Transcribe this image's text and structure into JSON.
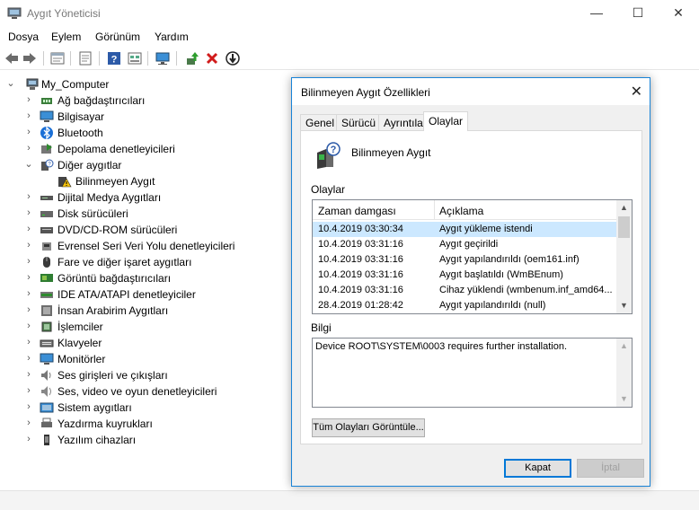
{
  "window": {
    "title": "Aygıt Yöneticisi",
    "controls": {
      "minimize": "—",
      "maximize": "☐",
      "close": "✕"
    }
  },
  "menu": [
    "Dosya",
    "Eylem",
    "Görünüm",
    "Yardım"
  ],
  "toolbar": [
    "back-icon",
    "forward-icon",
    "properties-icon",
    "show-hidden-icon",
    "help-icon",
    "view-icon",
    "monitor-icon",
    "update-driver-icon",
    "uninstall-icon",
    "disable-icon"
  ],
  "tree": {
    "root": "My_Computer",
    "items": [
      {
        "label": "Ağ bağdaştırıcıları",
        "expanded": false
      },
      {
        "label": "Bilgisayar",
        "expanded": false
      },
      {
        "label": "Bluetooth",
        "expanded": false
      },
      {
        "label": "Depolama denetleyicileri",
        "expanded": false
      },
      {
        "label": "Diğer aygıtlar",
        "expanded": true
      },
      {
        "label": "Bilinmeyen Aygıt",
        "child": true
      },
      {
        "label": "Dijital Medya Aygıtları",
        "expanded": false
      },
      {
        "label": "Disk sürücüleri",
        "expanded": false
      },
      {
        "label": "DVD/CD-ROM sürücüleri",
        "expanded": false
      },
      {
        "label": "Evrensel Seri Veri Yolu denetleyicileri",
        "expanded": false
      },
      {
        "label": "Fare ve diğer işaret aygıtları",
        "expanded": false
      },
      {
        "label": "Görüntü bağdaştırıcıları",
        "expanded": false
      },
      {
        "label": "IDE ATA/ATAPI denetleyiciler",
        "expanded": false
      },
      {
        "label": "İnsan Arabirim Aygıtları",
        "expanded": false
      },
      {
        "label": "İşlemciler",
        "expanded": false
      },
      {
        "label": "Klavyeler",
        "expanded": false
      },
      {
        "label": "Monitörler",
        "expanded": false
      },
      {
        "label": "Ses girişleri ve çıkışları",
        "expanded": false
      },
      {
        "label": "Ses, video ve oyun denetleyicileri",
        "expanded": false
      },
      {
        "label": "Sistem aygıtları",
        "expanded": false
      },
      {
        "label": "Yazdırma kuyrukları",
        "expanded": false
      },
      {
        "label": "Yazılım cihazları",
        "expanded": false
      }
    ]
  },
  "dialog": {
    "title": "Bilinmeyen Aygıt Özellikleri",
    "tabs": [
      "Genel",
      "Sürücü",
      "Ayrıntılar",
      "Olaylar"
    ],
    "active_tab": "Olaylar",
    "device_name": "Bilinmeyen Aygıt",
    "events_label": "Olaylar",
    "columns": [
      "Zaman damgası",
      "Açıklama"
    ],
    "events": [
      {
        "time": "10.4.2019 03:30:34",
        "desc": "Aygıt yükleme istendi",
        "selected": true
      },
      {
        "time": "10.4.2019 03:31:16",
        "desc": "Aygıt geçirildi"
      },
      {
        "time": "10.4.2019 03:31:16",
        "desc": "Aygıt yapılandırıldı (oem161.inf)"
      },
      {
        "time": "10.4.2019 03:31:16",
        "desc": "Aygıt başlatıldı (WmBEnum)"
      },
      {
        "time": "10.4.2019 03:31:16",
        "desc": "Cihaz yüklendi (wmbenum.inf_amd64..."
      },
      {
        "time": "28.4.2019 01:28:42",
        "desc": "Aygıt yapılandırıldı (null)"
      }
    ],
    "info_label": "Bilgi",
    "info_text": "Device ROOT\\SYSTEM\\0003 requires further installation.",
    "view_all_button": "Tüm Olayları Görüntüle...",
    "ok_button": "Kapat",
    "cancel_button": "İptal"
  }
}
